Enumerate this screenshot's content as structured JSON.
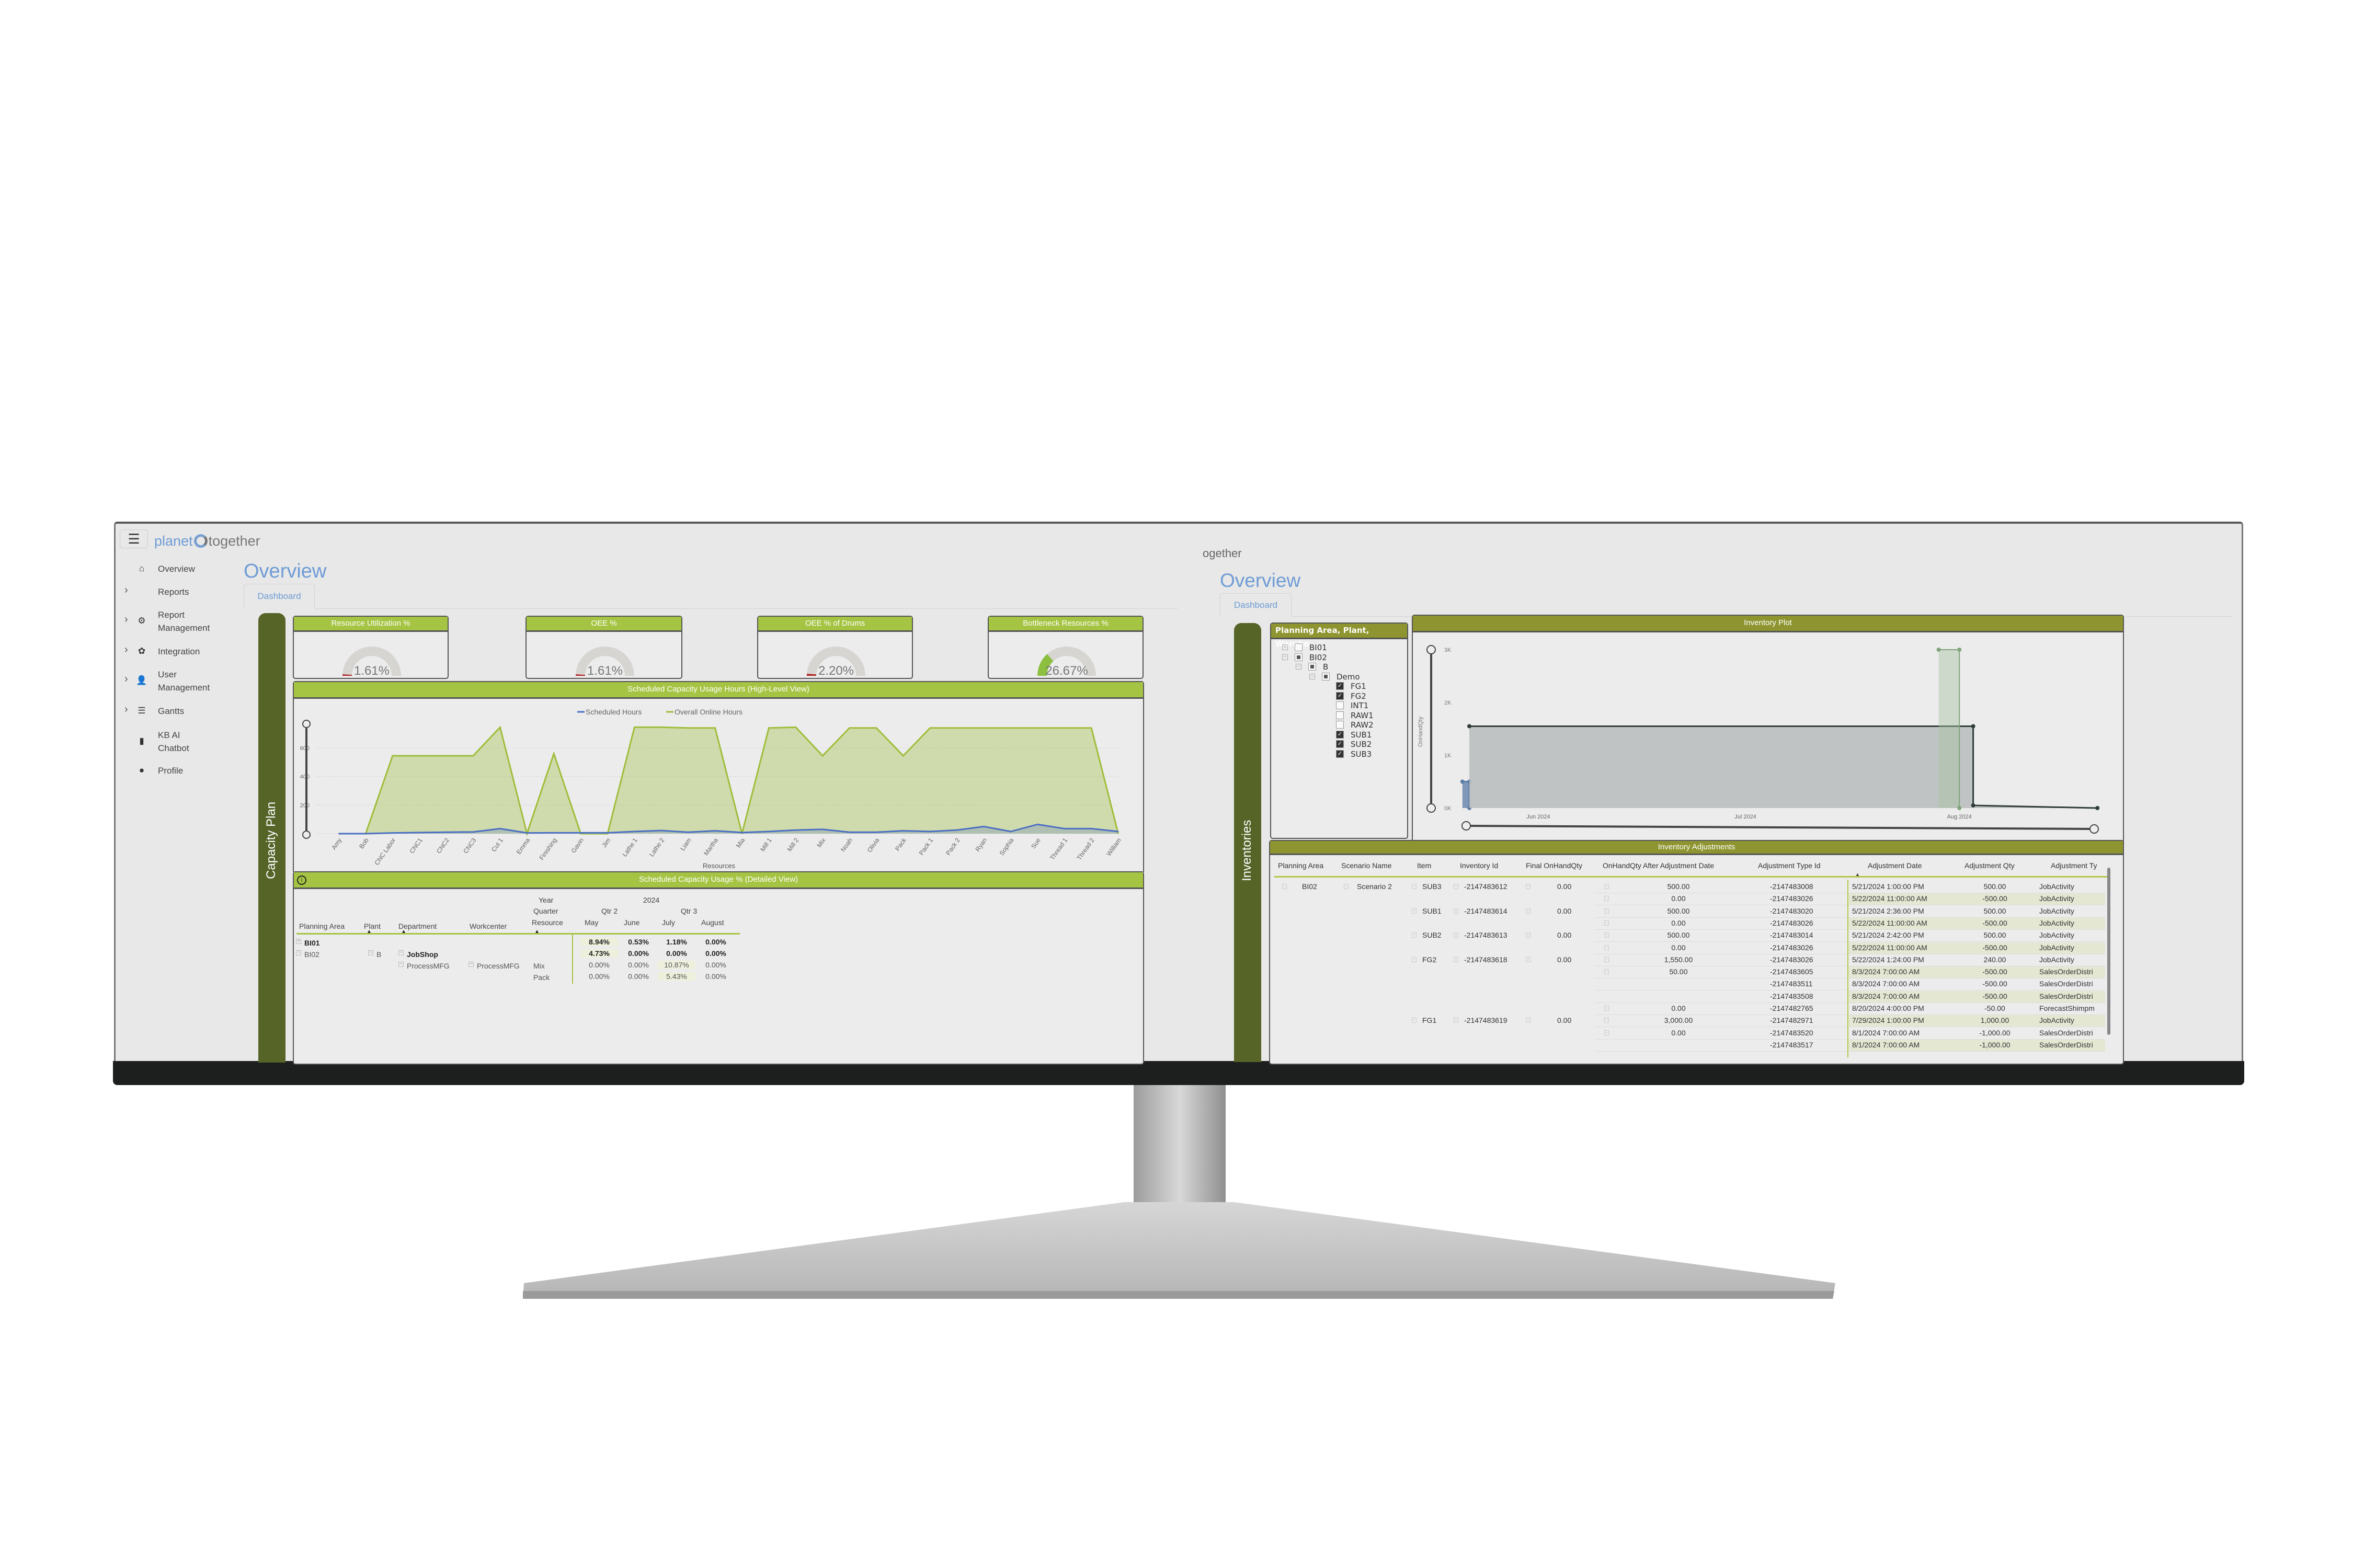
{
  "app": {
    "logo_left": "planet",
    "logo_right": "together",
    "logo_fragment": "ogether"
  },
  "sidebar": {
    "items": [
      {
        "label": "Overview",
        "icon": "home-icon",
        "glyph": "⌂",
        "chevron": false
      },
      {
        "label": "Reports",
        "icon": "",
        "glyph": "",
        "chevron": true
      },
      {
        "label": "Report\nManagement",
        "icon": "gears-icon",
        "glyph": "⚙",
        "chevron": true
      },
      {
        "label": "Integration",
        "icon": "gear-icon",
        "glyph": "✿",
        "chevron": true
      },
      {
        "label": "User\nManagement",
        "icon": "user-plus-icon",
        "glyph": "👤",
        "chevron": true
      },
      {
        "label": "Gantts",
        "icon": "checklist-icon",
        "glyph": "☰",
        "chevron": true
      },
      {
        "label": "KB AI\nChatbot",
        "icon": "book-icon",
        "glyph": "▮",
        "chevron": false
      },
      {
        "label": "Profile",
        "icon": "user-icon",
        "glyph": "●",
        "chevron": false
      }
    ]
  },
  "left": {
    "title": "Overview",
    "tab": "Dashboard",
    "section_label": "Capacity Plan",
    "gauges": [
      {
        "title": "Resource Utilization %",
        "value": 1.61,
        "label": "1.61%",
        "color": "#b22222"
      },
      {
        "title": "OEE %",
        "value": 1.61,
        "label": "1.61%",
        "color": "#b22222"
      },
      {
        "title": "OEE % of Drums",
        "value": 2.2,
        "label": "2.20%",
        "color": "#b22222"
      },
      {
        "title": "Bottleneck Resources %",
        "value": 26.67,
        "label": "26.67%",
        "color": "#8cbf3f"
      }
    ],
    "capacity_chart": {
      "title": "Scheduled Capacity Usage Hours (High-Level View)"
    },
    "detail": {
      "title": "Scheduled Capacity Usage % (Detailed View)",
      "year_label": "Year",
      "year": "2024",
      "quarter_label": "Quarter",
      "quarters": [
        "Qtr 2",
        "Qtr 3"
      ],
      "columns": [
        "Planning Area",
        "Plant",
        "Department",
        "Workcenter",
        "Resource"
      ],
      "months": [
        "May",
        "June",
        "July",
        "August"
      ],
      "rows": [
        {
          "area": "BI01",
          "plant": "",
          "dept": "",
          "wc": "",
          "res": "",
          "values": [
            "8.94%",
            "0.53%",
            "1.18%",
            "0.00%"
          ],
          "bold": true
        },
        {
          "area": "BI02",
          "plant": "B",
          "dept": "JobShop",
          "wc": "",
          "res": "",
          "values": [
            "4.73%",
            "0.00%",
            "0.00%",
            "0.00%"
          ],
          "bold": true
        },
        {
          "area": "",
          "plant": "",
          "dept": "ProcessMFG",
          "wc": "ProcessMFG",
          "res": "Mix",
          "values": [
            "0.00%",
            "0.00%",
            "10.87%",
            "0.00%"
          ],
          "bold": false
        },
        {
          "area": "",
          "plant": "",
          "dept": "",
          "wc": "",
          "res": "Pack",
          "values": [
            "0.00%",
            "0.00%",
            "5.43%",
            "0.00%"
          ],
          "bold": false
        }
      ]
    }
  },
  "right": {
    "title": "Overview",
    "tab": "Dashboard",
    "section_label": "Inventories",
    "tree": {
      "title": "Planning Area, Plant, Wareho...",
      "nodes": [
        {
          "label": "BI01",
          "level": 0,
          "state": "unchecked",
          "expander": "+"
        },
        {
          "label": "BI02",
          "level": 0,
          "state": "partial",
          "expander": "−"
        },
        {
          "label": "B",
          "level": 1,
          "state": "partial",
          "expander": "−"
        },
        {
          "label": "Demo",
          "level": 2,
          "state": "partial",
          "expander": "−"
        },
        {
          "label": "FG1",
          "level": 3,
          "state": "checked",
          "expander": ""
        },
        {
          "label": "FG2",
          "level": 3,
          "state": "checked",
          "expander": ""
        },
        {
          "label": "INT1",
          "level": 3,
          "state": "unchecked",
          "expander": ""
        },
        {
          "label": "RAW1",
          "level": 3,
          "state": "unchecked",
          "expander": ""
        },
        {
          "label": "RAW2",
          "level": 3,
          "state": "unchecked",
          "expander": ""
        },
        {
          "label": "SUB1",
          "level": 3,
          "state": "checked",
          "expander": ""
        },
        {
          "label": "SUB2",
          "level": 3,
          "state": "checked",
          "expander": ""
        },
        {
          "label": "SUB3",
          "level": 3,
          "state": "checked",
          "expander": ""
        }
      ]
    },
    "adjustments": {
      "title": "Inventory Adjustments",
      "columns": [
        "Planning Area",
        "Scenario Name",
        "Item",
        "Inventory Id",
        "Final OnHandQty",
        "OnHandQty After Adjustment Date",
        "Adjustment Type Id",
        "Adjustment Date",
        "Adjustment Qty",
        "Adjustment Ty"
      ],
      "planning_area": "BI02",
      "scenario": "Scenario 2",
      "items": [
        {
          "row": 0,
          "item": "SUB3",
          "inventory_id": "-2147483612",
          "final": "0.00"
        },
        {
          "row": 2,
          "item": "SUB1",
          "inventory_id": "-2147483614",
          "final": "0.00"
        },
        {
          "row": 4,
          "item": "SUB2",
          "inventory_id": "-2147483613",
          "final": "0.00"
        },
        {
          "row": 6,
          "item": "FG2",
          "inventory_id": "-2147483618",
          "final": "0.00"
        },
        {
          "row": 11,
          "item": "FG1",
          "inventory_id": "-2147483619",
          "final": "0.00"
        }
      ],
      "rows": [
        {
          "after": "500.00",
          "type_id": "-2147483008",
          "date": "5/21/2024 1:00:00 PM",
          "qty": "500.00",
          "type": "JobActivity"
        },
        {
          "after": "0.00",
          "type_id": "-2147483026",
          "date": "5/22/2024 11:00:00 AM",
          "qty": "-500.00",
          "type": "JobActivity"
        },
        {
          "after": "500.00",
          "type_id": "-2147483020",
          "date": "5/21/2024 2:36:00 PM",
          "qty": "500.00",
          "type": "JobActivity"
        },
        {
          "after": "0.00",
          "type_id": "-2147483026",
          "date": "5/22/2024 11:00:00 AM",
          "qty": "-500.00",
          "type": "JobActivity"
        },
        {
          "after": "500.00",
          "type_id": "-2147483014",
          "date": "5/21/2024 2:42:00 PM",
          "qty": "500.00",
          "type": "JobActivity"
        },
        {
          "after": "0.00",
          "type_id": "-2147483026",
          "date": "5/22/2024 11:00:00 AM",
          "qty": "-500.00",
          "type": "JobActivity"
        },
        {
          "after": "1,550.00",
          "type_id": "-2147483026",
          "date": "5/22/2024 1:24:00 PM",
          "qty": "240.00",
          "type": "JobActivity"
        },
        {
          "after": "50.00",
          "type_id": "-2147483605",
          "date": "8/3/2024 7:00:00 AM",
          "qty": "-500.00",
          "type": "SalesOrderDistri"
        },
        {
          "after": "",
          "type_id": "-2147483511",
          "date": "8/3/2024 7:00:00 AM",
          "qty": "-500.00",
          "type": "SalesOrderDistri"
        },
        {
          "after": "",
          "type_id": "-2147483508",
          "date": "8/3/2024 7:00:00 AM",
          "qty": "-500.00",
          "type": "SalesOrderDistri"
        },
        {
          "after": "0.00",
          "type_id": "-2147482765",
          "date": "8/20/2024 4:00:00 PM",
          "qty": "-50.00",
          "type": "ForecastShimpm"
        },
        {
          "after": "3,000.00",
          "type_id": "-2147482971",
          "date": "7/29/2024 1:00:00 PM",
          "qty": "1,000.00",
          "type": "JobActivity"
        },
        {
          "after": "0.00",
          "type_id": "-2147483520",
          "date": "8/1/2024 7:00:00 AM",
          "qty": "-1,000.00",
          "type": "SalesOrderDistri"
        },
        {
          "after": "",
          "type_id": "-2147483517",
          "date": "8/1/2024 7:00:00 AM",
          "qty": "-1,000.00",
          "type": "SalesOrderDistri"
        }
      ]
    }
  },
  "colors": {
    "lime_header": "#a6c443",
    "olive_header": "#8e9530",
    "section_bar": "#566428",
    "accent_blue": "#6f9bd6",
    "scheduled": "#4a6fc4",
    "online": "#9fbd3a"
  },
  "chart_data": [
    {
      "type": "area",
      "title": "Scheduled Capacity Usage Hours (High-Level View)",
      "xlabel": "Resources",
      "ylabel": "",
      "ylim": [
        0,
        760
      ],
      "yticks": [
        0,
        200,
        400,
        600
      ],
      "grid": true,
      "legend": "top",
      "categories": [
        "Amy",
        "Bob",
        "CNC Labor",
        "CNC1",
        "CNC2",
        "CNC3",
        "Cut 1",
        "Emma",
        "Finishing",
        "Gavin",
        "Jim",
        "Lathe 1",
        "Lathe 2",
        "Liam",
        "Martha",
        "Mia",
        "Mill 1",
        "Mill 2",
        "Mix",
        "Noah",
        "Olivia",
        "Pack",
        "Pack 1",
        "Pack 2",
        "Ryan",
        "Sophia",
        "Sue",
        "Thread 1",
        "Thread 2",
        "William"
      ],
      "series": [
        {
          "name": "Scheduled Hours",
          "color": "#4a6fc4",
          "values": [
            0,
            0,
            5,
            8,
            10,
            12,
            35,
            5,
            6,
            6,
            6,
            15,
            22,
            10,
            20,
            8,
            15,
            25,
            30,
            10,
            10,
            20,
            15,
            25,
            50,
            15,
            65,
            35,
            35,
            15
          ]
        },
        {
          "name": "Overall Online Hours",
          "color": "#9fbd3a",
          "values": [
            0,
            0,
            545,
            545,
            545,
            545,
            745,
            0,
            560,
            0,
            0,
            745,
            745,
            740,
            740,
            0,
            740,
            745,
            545,
            740,
            740,
            545,
            740,
            740,
            740,
            740,
            740,
            740,
            740,
            0
          ]
        }
      ]
    },
    {
      "type": "area",
      "title": "Inventory Plot",
      "ylabel": "OnHandQty",
      "ylim": [
        0,
        3000
      ],
      "yticks": [
        "0K",
        "1K",
        "2K",
        "3K"
      ],
      "xticks": [
        "Jun 2024",
        "Jul 2024",
        "Aug 2024"
      ],
      "xlim": [
        "2024-05-20",
        "2024-08-21"
      ],
      "series": [
        {
          "color": "#5f7fa8",
          "points": [
            [
              "2024-05-21",
              500
            ],
            [
              "2024-05-22",
              500
            ],
            [
              "2024-05-22",
              0
            ]
          ]
        },
        {
          "color": "#2f3d3a",
          "points": [
            [
              "2024-05-22",
              1550
            ],
            [
              "2024-08-03",
              1550
            ],
            [
              "2024-08-03",
              50
            ],
            [
              "2024-08-21",
              0
            ]
          ]
        },
        {
          "color": "#7fa57a",
          "points": [
            [
              "2024-07-29",
              3000
            ],
            [
              "2024-08-01",
              3000
            ],
            [
              "2024-08-01",
              0
            ]
          ]
        }
      ]
    }
  ]
}
